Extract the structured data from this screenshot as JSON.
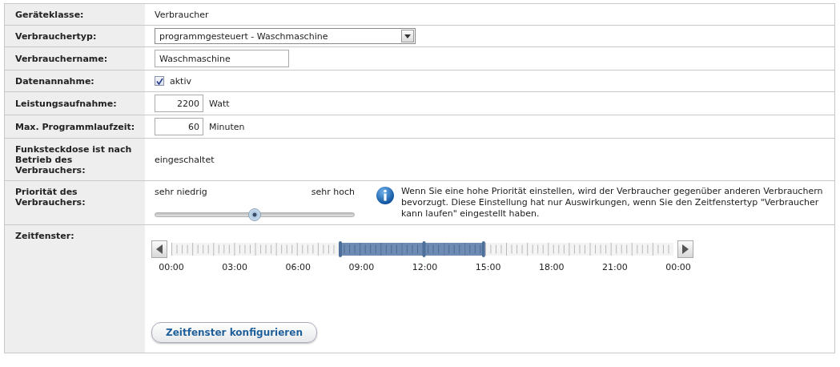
{
  "rows": [
    {
      "kind": "text",
      "label": "Geräteklasse:",
      "value": "Verbraucher"
    },
    {
      "kind": "select",
      "label": "Verbrauchertyp:",
      "value": "programmgesteuert - Waschmaschine"
    },
    {
      "kind": "input",
      "label": "Verbrauchername:",
      "value": "Waschmaschine"
    },
    {
      "kind": "checkbox",
      "label": "Datenannahme:",
      "checked": true,
      "text": "aktiv"
    },
    {
      "kind": "number",
      "label": "Leistungsaufnahme:",
      "value": "2200",
      "unit": "Watt"
    },
    {
      "kind": "number",
      "label": "Max. Programmlaufzeit:",
      "value": "60",
      "unit": "Minuten"
    },
    {
      "kind": "text",
      "label": "Funksteckdose ist nach Betrieb des Verbrauchers:",
      "value": "eingeschaltet"
    },
    {
      "kind": "slider",
      "label": "Priorität des Verbrauchers:",
      "min_label": "sehr niedrig",
      "max_label": "sehr hoch",
      "level": 0.5,
      "info": "Wenn Sie eine hohe Priorität einstellen, wird der Verbraucher gegenüber anderen Verbrauchern bevorzugt. Diese Einstellung hat nur Auswirkungen, wenn Sie den Zeitfenstertyp \"Verbraucher kann laufen\" eingestellt haben."
    },
    {
      "kind": "timeline",
      "label": "Zeitfenster:",
      "slots": [
        {
          "selected": false
        },
        {
          "selected": false
        },
        {
          "selected": false
        },
        {
          "selected": false
        },
        {
          "selected": false
        },
        {
          "selected": false
        },
        {
          "selected": false
        },
        {
          "selected": false
        },
        {
          "selected": true
        },
        {
          "selected": true
        },
        {
          "selected": true
        },
        {
          "selected": true
        },
        {
          "selected": true,
          "split": true
        },
        {
          "selected": true
        },
        {
          "selected": true
        },
        {
          "selected": false
        },
        {
          "selected": false
        },
        {
          "selected": false
        },
        {
          "selected": false
        },
        {
          "selected": false
        },
        {
          "selected": false
        },
        {
          "selected": false
        },
        {
          "selected": false
        },
        {
          "selected": false
        }
      ],
      "ticks": [
        "00:00",
        "03:00",
        "06:00",
        "09:00",
        "12:00",
        "15:00",
        "18:00",
        "21:00",
        "00:00"
      ],
      "button": "Zeitfenster konfigurieren"
    }
  ]
}
